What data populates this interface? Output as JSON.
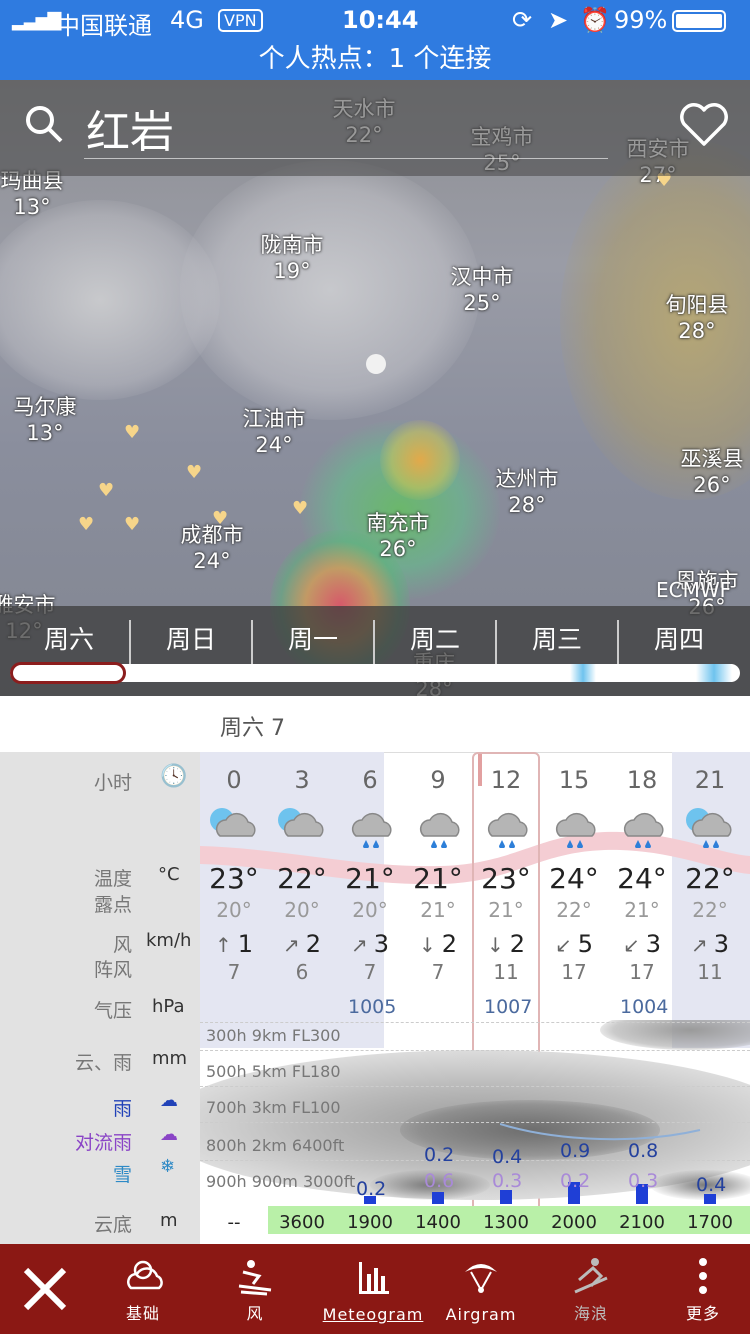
{
  "status_bar": {
    "carrier": "中国联通",
    "network": "4G",
    "vpn": "VPN",
    "time": "10:44",
    "battery": "99%"
  },
  "hotspot": "个人热点：1 个连接",
  "search": {
    "location": "红岩"
  },
  "map": {
    "cities": [
      {
        "name": "天水市",
        "temp": "22°"
      },
      {
        "name": "宝鸡市",
        "temp": "25°"
      },
      {
        "name": "西安市",
        "temp": "27°"
      },
      {
        "name": "玛曲县",
        "temp": "13°"
      },
      {
        "name": "陇南市",
        "temp": "19°"
      },
      {
        "name": "汉中市",
        "temp": "25°"
      },
      {
        "name": "旬阳县",
        "temp": "28°"
      },
      {
        "name": "马尔康",
        "temp": "13°"
      },
      {
        "name": "江油市",
        "temp": "24°"
      },
      {
        "name": "巫溪县",
        "temp": "26°"
      },
      {
        "name": "达州市",
        "temp": "28°"
      },
      {
        "name": "成都市",
        "temp": "24°"
      },
      {
        "name": "南充市",
        "temp": "26°"
      },
      {
        "name": "恩施市",
        "temp": "26°"
      },
      {
        "name": "雅安市",
        "temp": "12°"
      },
      {
        "name": "重庆",
        "temp": "28°"
      }
    ],
    "model_label": "ECMWF",
    "days": [
      "周六",
      "周日",
      "周一",
      "周二",
      "周三",
      "周四"
    ]
  },
  "meteogram": {
    "date_label": "周六 7",
    "labels": {
      "hour": "小时",
      "temp": "温度",
      "dew": "露点",
      "temp_unit": "°C",
      "wind": "风",
      "gust": "阵风",
      "wind_unit": "km/h",
      "pressure": "气压",
      "pressure_unit": "hPa",
      "cloud_rain": "云、雨",
      "cloud_unit": "mm",
      "rain": "雨",
      "conv_rain": "对流雨",
      "snow": "雪",
      "cloud_base": "云底",
      "cloud_base_unit": "m"
    },
    "hours": [
      "0",
      "3",
      "6",
      "9",
      "12",
      "15",
      "18",
      "21"
    ],
    "icons": [
      "partly-cloudy-icon",
      "partly-cloudy-icon",
      "rain-cloud-icon",
      "rain-cloud-icon",
      "rain-cloud-icon",
      "rain-cloud-icon",
      "rain-cloud-icon",
      "partly-rain-icon"
    ],
    "temps": [
      "23°",
      "22°",
      "21°",
      "21°",
      "23°",
      "24°",
      "24°",
      "22°"
    ],
    "dews": [
      "20°",
      "20°",
      "20°",
      "21°",
      "21°",
      "22°",
      "21°",
      "22°"
    ],
    "winds": [
      "1",
      "2",
      "3",
      "2",
      "2",
      "5",
      "3",
      "3"
    ],
    "wind_arrows": [
      "↑",
      "↗",
      "↗",
      "↓",
      "↓",
      "↙",
      "↙",
      "↗"
    ],
    "gusts": [
      "7",
      "6",
      "7",
      "7",
      "11",
      "17",
      "17",
      "11"
    ],
    "pressures": [
      "1005",
      "1007",
      "1004"
    ],
    "altitudes": [
      "300h 9km FL300",
      "500h 5km FL180",
      "700h 3km FL100",
      "800h 2km 6400ft",
      "900h 900m 3000ft"
    ],
    "rain_values": [
      "0.2",
      "0.2",
      "0.4",
      "0.9",
      "0.8",
      "0.4"
    ],
    "rain_fractions": [
      0.08,
      0.12,
      0.14,
      0.22,
      0.2,
      0.1
    ],
    "conv_values": [
      "0.6",
      "0.3",
      "0.2",
      "0.3"
    ],
    "cloud_base": [
      "--",
      "3600",
      "1900",
      "1400",
      "1300",
      "2000",
      "2100",
      "1700"
    ]
  },
  "nav": [
    {
      "label": "基础",
      "icon": "basic-weather-icon"
    },
    {
      "label": "风",
      "icon": "wind-surf-icon"
    },
    {
      "label": "Meteogram",
      "icon": "meteogram-icon"
    },
    {
      "label": "Airgram",
      "icon": "paraglider-icon"
    },
    {
      "label": "海浪",
      "icon": "surfer-icon"
    },
    {
      "label": "更多",
      "icon": "more-icon"
    }
  ],
  "colors": {
    "status_bar": "#2f7be0",
    "nav_bar": "#8b1814",
    "selected_outline": "#8b1d1d"
  }
}
